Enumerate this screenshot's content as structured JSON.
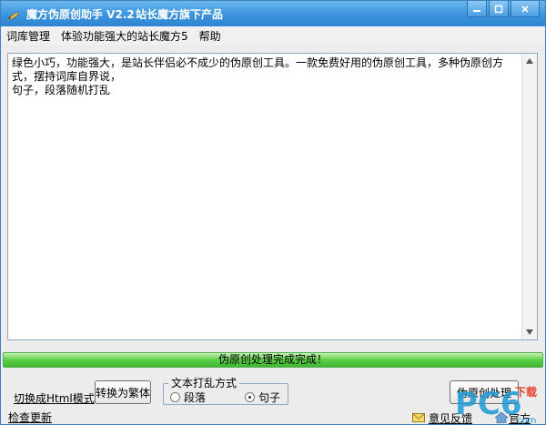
{
  "title": {
    "app": "魔方伪原创助手  V2.2",
    "sub": "站长魔方旗下产品"
  },
  "window_buttons": [
    "minimize-icon",
    "maximize-icon",
    "close-icon"
  ],
  "menu": [
    "词库管理",
    "体验功能强大的站长魔方5",
    "帮助"
  ],
  "content": {
    "text_line1": "绿色小巧，功能强大，是站长伴侣必不成少的伪原创工具。一款免费好用的伪原创工具，多种伪原创方式，摆持词库自界说，",
    "text_line2": "句子，段落随机打乱"
  },
  "status": {
    "text": "伪原创处理完成完成！",
    "progress": 1.0
  },
  "bottom": {
    "switch_html": "切换成Html模式",
    "check_update": "检查更新",
    "convert_btn": "转换为繁体",
    "group_title": "文本打乱方式",
    "radio_paragraph": "段落",
    "radio_sentence": "句子",
    "selected": "句子",
    "process_btn": "伪原创处理",
    "feedback": "意见反馈",
    "official": "官方"
  },
  "watermark": {
    "text": "PC6",
    "sub": "下载",
    "com": "com"
  },
  "colors": {
    "title_bar": "#3a93db",
    "status_green": "#5ccf46",
    "border_blue": "#8ea8c8"
  }
}
